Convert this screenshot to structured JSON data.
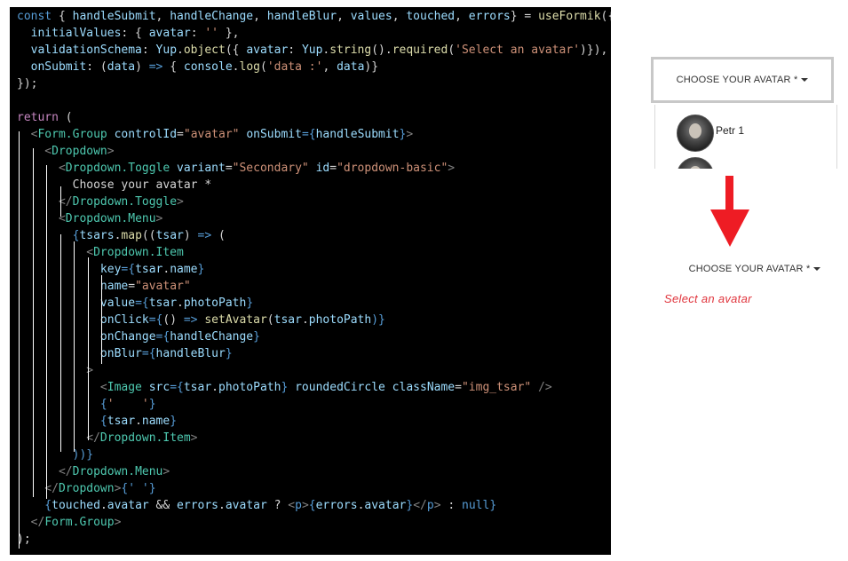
{
  "code": {
    "lines": [
      [
        [
          "const",
          "#569cd6"
        ],
        [
          " { ",
          "#d4d4d4"
        ],
        [
          "handleSubmit",
          "#9cdcfe"
        ],
        [
          ", ",
          "#d4d4d4"
        ],
        [
          "handleChange",
          "#9cdcfe"
        ],
        [
          ", ",
          "#d4d4d4"
        ],
        [
          "handleBlur",
          "#9cdcfe"
        ],
        [
          ", ",
          "#d4d4d4"
        ],
        [
          "values",
          "#9cdcfe"
        ],
        [
          ", ",
          "#d4d4d4"
        ],
        [
          "touched",
          "#9cdcfe"
        ],
        [
          ", ",
          "#d4d4d4"
        ],
        [
          "errors",
          "#9cdcfe"
        ],
        [
          "} = ",
          "#d4d4d4"
        ],
        [
          "useFormik",
          "#dcdcaa"
        ],
        [
          "({",
          "#d4d4d4"
        ]
      ],
      [
        [
          "  initialValues",
          "#9cdcfe"
        ],
        [
          ": { ",
          "#d4d4d4"
        ],
        [
          "avatar",
          "#9cdcfe"
        ],
        [
          ": ",
          "#d4d4d4"
        ],
        [
          "''",
          "#ce9178"
        ],
        [
          " },",
          "#d4d4d4"
        ]
      ],
      [
        [
          "  validationSchema",
          "#9cdcfe"
        ],
        [
          ": ",
          "#d4d4d4"
        ],
        [
          "Yup",
          "#9cdcfe"
        ],
        [
          ".",
          "#d4d4d4"
        ],
        [
          "object",
          "#dcdcaa"
        ],
        [
          "({ ",
          "#d4d4d4"
        ],
        [
          "avatar",
          "#9cdcfe"
        ],
        [
          ": ",
          "#d4d4d4"
        ],
        [
          "Yup",
          "#9cdcfe"
        ],
        [
          ".",
          "#d4d4d4"
        ],
        [
          "string",
          "#dcdcaa"
        ],
        [
          "().",
          "#d4d4d4"
        ],
        [
          "required",
          "#dcdcaa"
        ],
        [
          "(",
          "#d4d4d4"
        ],
        [
          "'Select an avatar'",
          "#ce9178"
        ],
        [
          ")}),",
          "#d4d4d4"
        ]
      ],
      [
        [
          "  onSubmit",
          "#9cdcfe"
        ],
        [
          ": (",
          "#d4d4d4"
        ],
        [
          "data",
          "#9cdcfe"
        ],
        [
          ") ",
          "#d4d4d4"
        ],
        [
          "=>",
          "#569cd6"
        ],
        [
          " { ",
          "#d4d4d4"
        ],
        [
          "console",
          "#9cdcfe"
        ],
        [
          ".",
          "#d4d4d4"
        ],
        [
          "log",
          "#dcdcaa"
        ],
        [
          "(",
          "#d4d4d4"
        ],
        [
          "'data :'",
          "#ce9178"
        ],
        [
          ", ",
          "#d4d4d4"
        ],
        [
          "data",
          "#9cdcfe"
        ],
        [
          ")}",
          "#d4d4d4"
        ]
      ],
      [
        [
          "});",
          "#d4d4d4"
        ]
      ],
      [
        [
          "",
          "#d4d4d4"
        ]
      ],
      [
        [
          "return",
          "#c586c0"
        ],
        [
          " (",
          "#d4d4d4"
        ]
      ],
      [
        [
          "  <",
          "#808080"
        ],
        [
          "Form.Group",
          "#4ec9b0"
        ],
        [
          " controlId",
          "#9cdcfe"
        ],
        [
          "=",
          "#d4d4d4"
        ],
        [
          "\"avatar\"",
          "#ce9178"
        ],
        [
          " onSubmit",
          "#9cdcfe"
        ],
        [
          "={",
          "#569cd6"
        ],
        [
          "handleSubmit",
          "#9cdcfe"
        ],
        [
          "}",
          "#569cd6"
        ],
        [
          ">",
          "#808080"
        ]
      ],
      [
        [
          "    <",
          "#808080"
        ],
        [
          "Dropdown",
          "#4ec9b0"
        ],
        [
          ">",
          "#808080"
        ]
      ],
      [
        [
          "      <",
          "#808080"
        ],
        [
          "Dropdown.Toggle",
          "#4ec9b0"
        ],
        [
          " variant",
          "#9cdcfe"
        ],
        [
          "=",
          "#d4d4d4"
        ],
        [
          "\"Secondary\"",
          "#ce9178"
        ],
        [
          " id",
          "#9cdcfe"
        ],
        [
          "=",
          "#d4d4d4"
        ],
        [
          "\"dropdown-basic\"",
          "#ce9178"
        ],
        [
          ">",
          "#808080"
        ]
      ],
      [
        [
          "        Choose your avatar *",
          "#d4d4d4"
        ]
      ],
      [
        [
          "      </",
          "#808080"
        ],
        [
          "Dropdown.Toggle",
          "#4ec9b0"
        ],
        [
          ">",
          "#808080"
        ]
      ],
      [
        [
          "      <",
          "#808080"
        ],
        [
          "Dropdown.Menu",
          "#4ec9b0"
        ],
        [
          ">",
          "#808080"
        ]
      ],
      [
        [
          "        {",
          "#569cd6"
        ],
        [
          "tsars",
          "#9cdcfe"
        ],
        [
          ".",
          "#d4d4d4"
        ],
        [
          "map",
          "#dcdcaa"
        ],
        [
          "((",
          "#d4d4d4"
        ],
        [
          "tsar",
          "#9cdcfe"
        ],
        [
          ") ",
          "#d4d4d4"
        ],
        [
          "=>",
          "#569cd6"
        ],
        [
          " (",
          "#d4d4d4"
        ]
      ],
      [
        [
          "          <",
          "#808080"
        ],
        [
          "Dropdown.Item",
          "#4ec9b0"
        ]
      ],
      [
        [
          "            key",
          "#9cdcfe"
        ],
        [
          "={",
          "#569cd6"
        ],
        [
          "tsar",
          "#9cdcfe"
        ],
        [
          ".",
          "#d4d4d4"
        ],
        [
          "name",
          "#9cdcfe"
        ],
        [
          "}",
          "#569cd6"
        ]
      ],
      [
        [
          "            name",
          "#9cdcfe"
        ],
        [
          "=",
          "#d4d4d4"
        ],
        [
          "\"avatar\"",
          "#ce9178"
        ]
      ],
      [
        [
          "            value",
          "#9cdcfe"
        ],
        [
          "={",
          "#569cd6"
        ],
        [
          "tsar",
          "#9cdcfe"
        ],
        [
          ".",
          "#d4d4d4"
        ],
        [
          "photoPath",
          "#9cdcfe"
        ],
        [
          "}",
          "#569cd6"
        ]
      ],
      [
        [
          "            onClick",
          "#9cdcfe"
        ],
        [
          "={",
          "#569cd6"
        ],
        [
          "() ",
          "#d4d4d4"
        ],
        [
          "=>",
          "#569cd6"
        ],
        [
          " ",
          "#d4d4d4"
        ],
        [
          "setAvatar",
          "#dcdcaa"
        ],
        [
          "(",
          "#d4d4d4"
        ],
        [
          "tsar",
          "#9cdcfe"
        ],
        [
          ".",
          "#d4d4d4"
        ],
        [
          "photoPath",
          "#9cdcfe"
        ],
        [
          ")}",
          "#569cd6"
        ]
      ],
      [
        [
          "            onChange",
          "#9cdcfe"
        ],
        [
          "={",
          "#569cd6"
        ],
        [
          "handleChange",
          "#9cdcfe"
        ],
        [
          "}",
          "#569cd6"
        ]
      ],
      [
        [
          "            onBlur",
          "#9cdcfe"
        ],
        [
          "={",
          "#569cd6"
        ],
        [
          "handleBlur",
          "#9cdcfe"
        ],
        [
          "}",
          "#569cd6"
        ]
      ],
      [
        [
          "          >",
          "#808080"
        ]
      ],
      [
        [
          "            <",
          "#808080"
        ],
        [
          "Image",
          "#4ec9b0"
        ],
        [
          " src",
          "#9cdcfe"
        ],
        [
          "={",
          "#569cd6"
        ],
        [
          "tsar",
          "#9cdcfe"
        ],
        [
          ".",
          "#d4d4d4"
        ],
        [
          "photoPath",
          "#9cdcfe"
        ],
        [
          "}",
          "#569cd6"
        ],
        [
          " roundedCircle",
          "#9cdcfe"
        ],
        [
          " className",
          "#9cdcfe"
        ],
        [
          "=",
          "#d4d4d4"
        ],
        [
          "\"img_tsar\"",
          "#ce9178"
        ],
        [
          " />",
          "#808080"
        ]
      ],
      [
        [
          "            {",
          "#569cd6"
        ],
        [
          "'    '",
          "#ce9178"
        ],
        [
          "}",
          "#569cd6"
        ]
      ],
      [
        [
          "            {",
          "#569cd6"
        ],
        [
          "tsar",
          "#9cdcfe"
        ],
        [
          ".",
          "#d4d4d4"
        ],
        [
          "name",
          "#9cdcfe"
        ],
        [
          "}",
          "#569cd6"
        ]
      ],
      [
        [
          "          </",
          "#808080"
        ],
        [
          "Dropdown.Item",
          "#4ec9b0"
        ],
        [
          ">",
          "#808080"
        ]
      ],
      [
        [
          "        ))}",
          "#569cd6"
        ]
      ],
      [
        [
          "      </",
          "#808080"
        ],
        [
          "Dropdown.Menu",
          "#4ec9b0"
        ],
        [
          ">",
          "#808080"
        ]
      ],
      [
        [
          "    </",
          "#808080"
        ],
        [
          "Dropdown",
          "#4ec9b0"
        ],
        [
          ">",
          "#808080"
        ],
        [
          "{' '}",
          "#569cd6"
        ]
      ],
      [
        [
          "    {",
          "#569cd6"
        ],
        [
          "touched",
          "#9cdcfe"
        ],
        [
          ".",
          "#d4d4d4"
        ],
        [
          "avatar",
          "#9cdcfe"
        ],
        [
          " && ",
          "#d4d4d4"
        ],
        [
          "errors",
          "#9cdcfe"
        ],
        [
          ".",
          "#d4d4d4"
        ],
        [
          "avatar",
          "#9cdcfe"
        ],
        [
          " ? ",
          "#d4d4d4"
        ],
        [
          "<",
          "#808080"
        ],
        [
          "p",
          "#569cd6"
        ],
        [
          ">",
          "#808080"
        ],
        [
          "{",
          "#569cd6"
        ],
        [
          "errors",
          "#9cdcfe"
        ],
        [
          ".",
          "#d4d4d4"
        ],
        [
          "avatar",
          "#9cdcfe"
        ],
        [
          "}",
          "#569cd6"
        ],
        [
          "</",
          "#808080"
        ],
        [
          "p",
          "#569cd6"
        ],
        [
          ">",
          "#808080"
        ],
        [
          " : ",
          "#d4d4d4"
        ],
        [
          "null",
          "#569cd6"
        ],
        [
          "}",
          "#569cd6"
        ]
      ],
      [
        [
          "  </",
          "#808080"
        ],
        [
          "Form.Group",
          "#4ec9b0"
        ],
        [
          ">",
          "#808080"
        ]
      ],
      [
        [
          ");",
          "#d4d4d4"
        ]
      ]
    ]
  },
  "dropdown_top": {
    "toggle_label": "CHOOSE YOUR AVATAR *",
    "items": [
      {
        "name": "Petr 1"
      }
    ]
  },
  "dropdown_bottom": {
    "toggle_label": "CHOOSE YOUR AVATAR *"
  },
  "error": {
    "message": "Select an avatar"
  },
  "colors": {
    "error": "#e0343c",
    "arrow": "#ee1c24",
    "code_bg": "#000000"
  }
}
